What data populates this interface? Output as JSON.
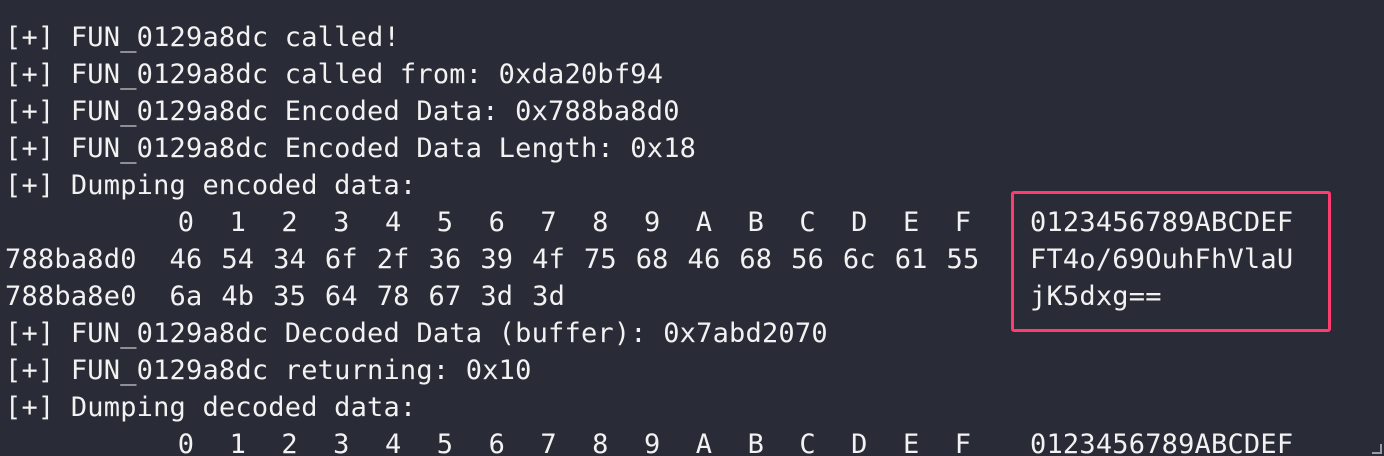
{
  "log_lines": {
    "l1": "[+] FUN_0129a8dc called!",
    "l2": "[+] FUN_0129a8dc called from: 0xda20bf94",
    "l3": "[+] FUN_0129a8dc Encoded Data: 0x788ba8d0",
    "l4": "[+] FUN_0129a8dc Encoded Data Length: 0x18",
    "l5": "[+] Dumping encoded data:",
    "l6": "[+] FUN_0129a8dc Decoded Data (buffer): 0x7abd2070",
    "l7": "[+] FUN_0129a8dc returning: 0x10",
    "l8": "[+] Dumping decoded data:"
  },
  "hexdump_columns": [
    "0",
    "1",
    "2",
    "3",
    "4",
    "5",
    "6",
    "7",
    "8",
    "9",
    "A",
    "B",
    "C",
    "D",
    "E",
    "F"
  ],
  "ascii_header": "0123456789ABCDEF",
  "encoded_dump": [
    {
      "address": "788ba8d0",
      "bytes": [
        "46",
        "54",
        "34",
        "6f",
        "2f",
        "36",
        "39",
        "4f",
        "75",
        "68",
        "46",
        "68",
        "56",
        "6c",
        "61",
        "55"
      ],
      "ascii": "FT4o/69OuhFhVlaU"
    },
    {
      "address": "788ba8e0",
      "bytes": [
        "6a",
        "4b",
        "35",
        "64",
        "78",
        "67",
        "3d",
        "3d"
      ],
      "ascii": "jK5dxg=="
    }
  ],
  "decoded_dump_header": {
    "columns": [
      "0",
      "1",
      "2",
      "3",
      "4",
      "5",
      "6",
      "7",
      "8",
      "9",
      "A",
      "B",
      "C",
      "D",
      "E",
      "F"
    ],
    "ascii": "0123456789ABCDEF"
  },
  "colors": {
    "background": "#292b36",
    "text": "#f2f2f2",
    "highlight": "#ff3b6f"
  }
}
